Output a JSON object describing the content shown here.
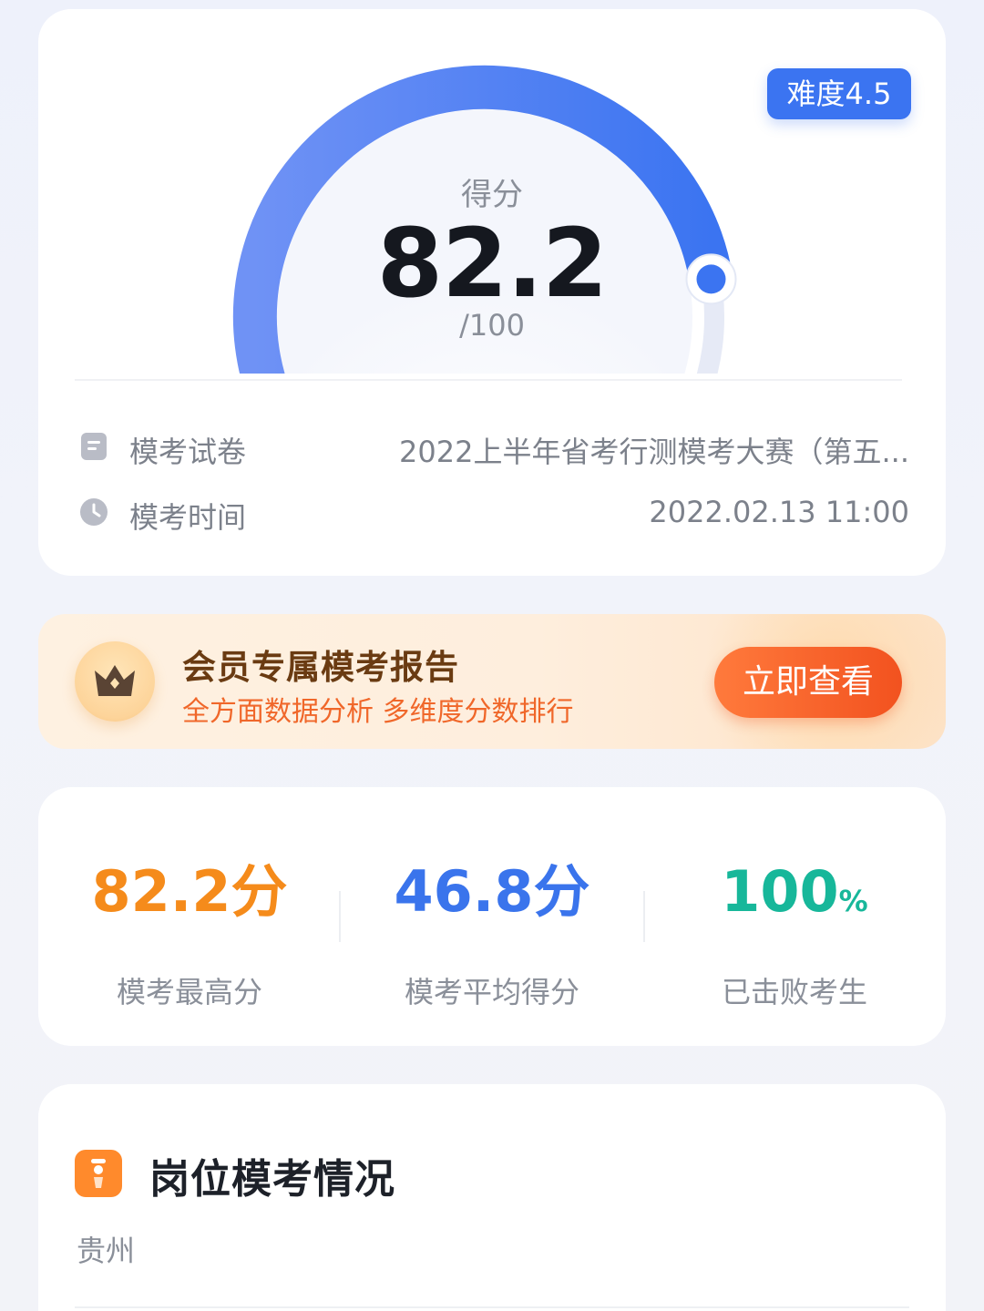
{
  "score_card": {
    "caption": "得分",
    "score": "82.2",
    "total": "/100",
    "score_fraction": 0.822,
    "difficulty": "难度4.5",
    "paper_label": "模考试卷",
    "paper_value": "2022上半年省考行测模考大赛（第五...",
    "time_label": "模考时间",
    "time_value": "2022.02.13 11:00",
    "gauge_color": "#3b74f1",
    "gauge_track_color": "#e6eaf6"
  },
  "member_banner": {
    "title": "会员专属模考报告",
    "subtitle": "全方面数据分析 多维度分数排行",
    "button_label": "立即查看",
    "icon": "crown-icon"
  },
  "stats": {
    "highest": {
      "value": "82.2分",
      "label": "模考最高分",
      "color": "#f58b1b"
    },
    "average": {
      "value": "46.8分",
      "label": "模考平均得分",
      "color": "#3a74ec"
    },
    "beaten": {
      "value": "100",
      "unit": "%",
      "label": "已击败考生",
      "color": "#17b79a"
    }
  },
  "position": {
    "title": "岗位模考情况",
    "region": "贵州",
    "icon": "badge-icon"
  }
}
